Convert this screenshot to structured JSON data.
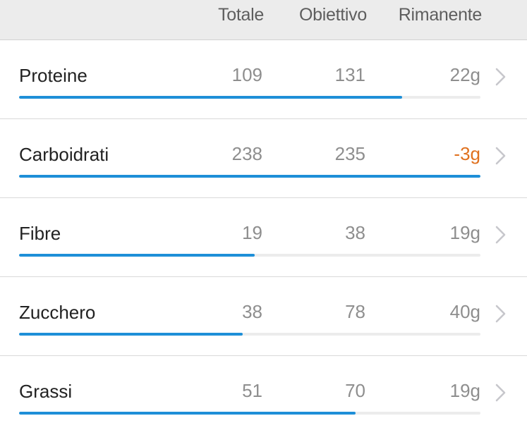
{
  "header": {
    "total_label": "Totale",
    "goal_label": "Obiettivo",
    "remaining_label": "Rimanente"
  },
  "colors": {
    "progress": "#1e8fd8",
    "negative": "#e0711f"
  },
  "nutrients": [
    {
      "name": "Proteine",
      "total": "109",
      "goal": "131",
      "remaining": "22g",
      "negative": false,
      "progress": 0.83
    },
    {
      "name": "Carboidrati",
      "total": "238",
      "goal": "235",
      "remaining": "-3g",
      "negative": true,
      "progress": 1.0
    },
    {
      "name": "Fibre",
      "total": "19",
      "goal": "38",
      "remaining": "19g",
      "negative": false,
      "progress": 0.51
    },
    {
      "name": "Zucchero",
      "total": "38",
      "goal": "78",
      "remaining": "40g",
      "negative": false,
      "progress": 0.485
    },
    {
      "name": "Grassi",
      "total": "51",
      "goal": "70",
      "remaining": "19g",
      "negative": false,
      "progress": 0.73
    }
  ]
}
